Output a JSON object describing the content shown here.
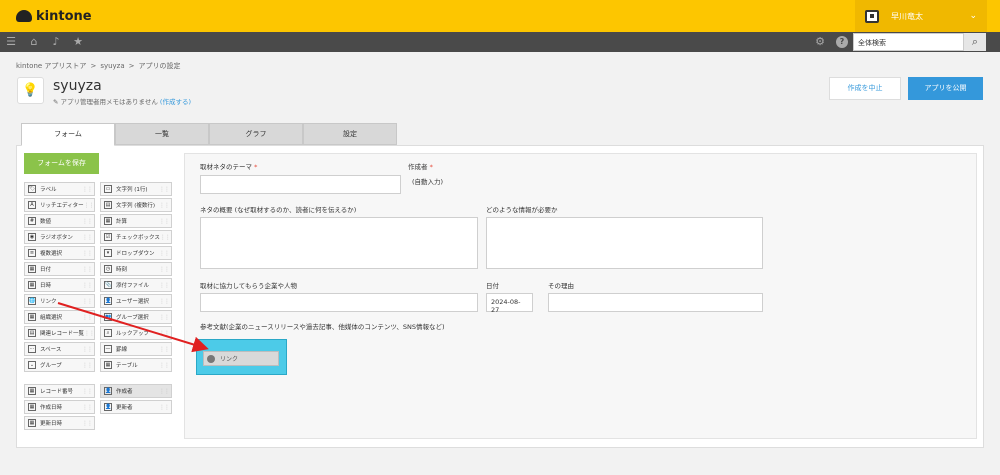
{
  "header": {
    "logo": "kintone",
    "user_name": "早川竜太"
  },
  "nav": {
    "search_placeholder": "全体検索"
  },
  "breadcrumb": [
    "kintone アプリストア",
    "syuyza",
    "アプリの設定"
  ],
  "app": {
    "title": "syuyza",
    "memo_text": "アプリ管理者用メモはありません",
    "memo_link": "(作成する)",
    "cancel_label": "作成を中止",
    "publish_label": "アプリを公開"
  },
  "tabs": [
    "フォーム",
    "一覧",
    "グラフ",
    "設定"
  ],
  "form": {
    "save_label": "フォームを保存"
  },
  "palette": [
    [
      "ラベル",
      "文字列 (1行)"
    ],
    [
      "リッチエディター",
      "文字列 (複数行)"
    ],
    [
      "数値",
      "計算"
    ],
    [
      "ラジオボタン",
      "チェックボックス"
    ],
    [
      "複数選択",
      "ドロップダウン"
    ],
    [
      "日付",
      "時刻"
    ],
    [
      "日時",
      "添付ファイル"
    ],
    [
      "リンク",
      "ユーザー選択"
    ],
    [
      "組織選択",
      "グループ選択"
    ],
    [
      "関連レコード一覧",
      "ルックアップ"
    ],
    [
      "スペース",
      "罫線"
    ],
    [
      "グループ",
      "テーブル"
    ]
  ],
  "system_fields": [
    [
      "レコード番号",
      "作成者"
    ],
    [
      "作成日時",
      "更新者"
    ],
    [
      "更新日時",
      ""
    ]
  ],
  "fields": {
    "theme_label": "取材ネタのテーマ",
    "author_label": "作成者",
    "author_value": "(自動入力)",
    "summary_label": "ネタの概要 (なぜ取材するのか、読者に何を伝えるか)",
    "info_label": "どのような情報が必要か",
    "partner_label": "取材に協力してもらう企業や人物",
    "date_label": "日付",
    "date_value": "2024-08-27",
    "reason_label": "その理由",
    "reference_label": "参考文献(企業のニュースリリースや過去記事、他媒体のコンテンツ、SNS情報など)",
    "drop_item_label": "リンク"
  },
  "colors": {
    "header": "#fdc600",
    "nav": "#4a4a4a",
    "primary": "#3498db",
    "save": "#8bc34a",
    "drop_zone": "#4ccbe8",
    "arrow": "#e02020"
  }
}
